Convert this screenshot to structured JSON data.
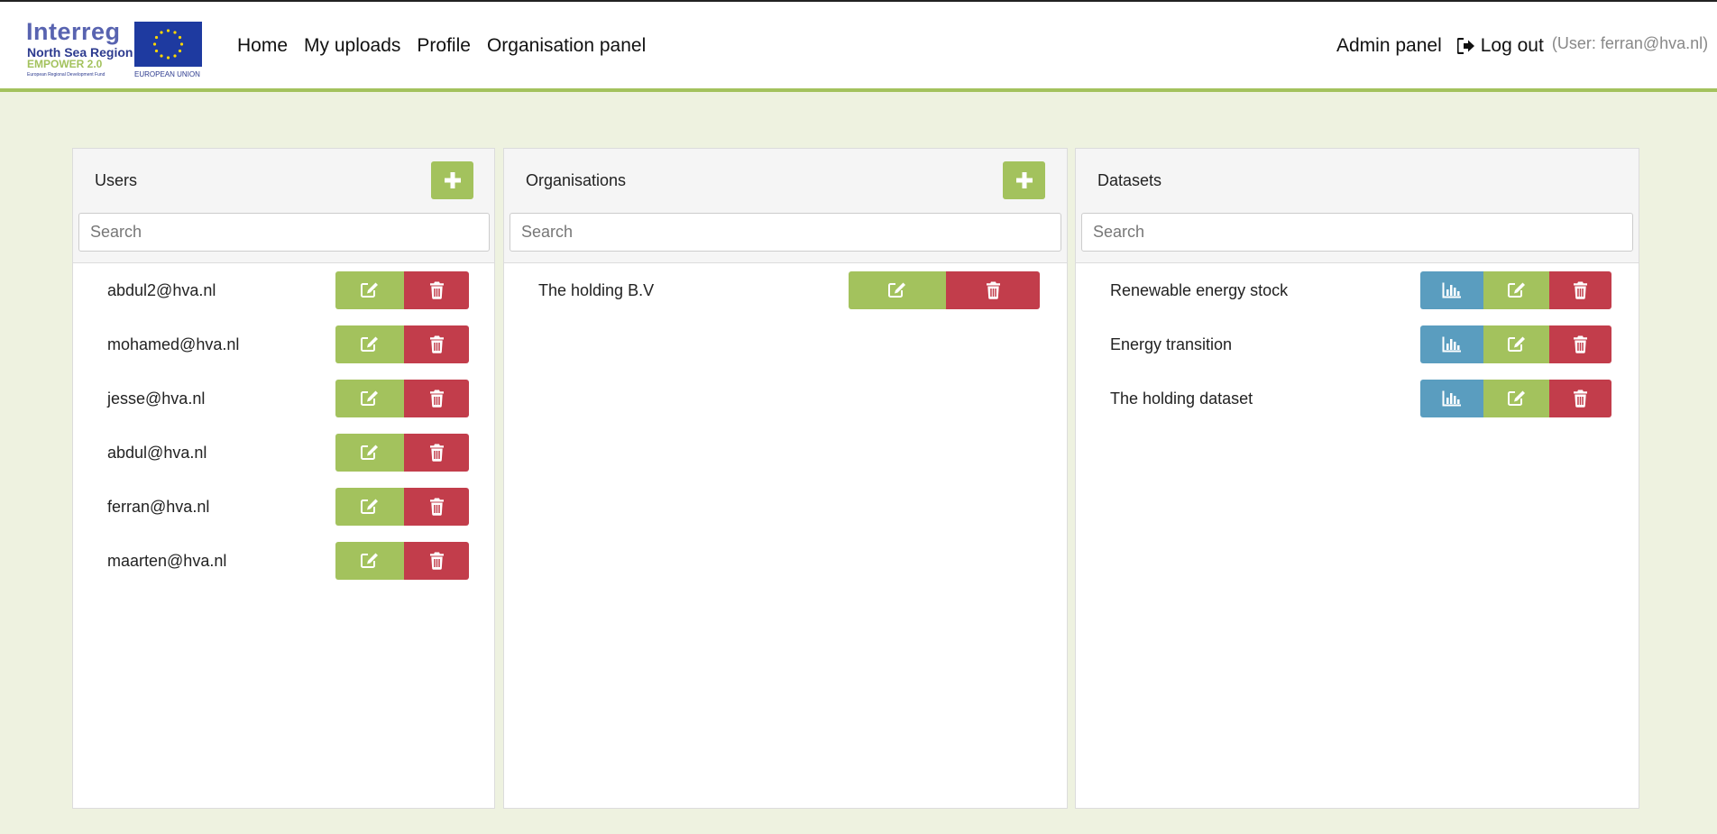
{
  "brand": {
    "title": "Interreg",
    "region": "North Sea Region",
    "project": "EMPOWER 2.0",
    "fund": "European Regional Development Fund",
    "eu_label": "EUROPEAN UNION"
  },
  "nav": {
    "home": "Home",
    "uploads": "My uploads",
    "profile": "Profile",
    "organisation_panel": "Organisation panel",
    "admin_panel": "Admin panel",
    "logout": "Log out",
    "user_info": "(User: ferran@hva.nl)"
  },
  "users": {
    "title": "Users",
    "search_placeholder": "Search",
    "items": [
      "abdul2@hva.nl",
      "mohamed@hva.nl",
      "jesse@hva.nl",
      "abdul@hva.nl",
      "ferran@hva.nl",
      "maarten@hva.nl"
    ]
  },
  "organisations": {
    "title": "Organisations",
    "search_placeholder": "Search",
    "items": [
      "The holding B.V"
    ]
  },
  "datasets": {
    "title": "Datasets",
    "search_placeholder": "Search",
    "items": [
      "Renewable energy stock",
      "Energy transition",
      "The holding dataset"
    ]
  },
  "colors": {
    "accent_green": "#a3c25d",
    "danger_red": "#c23d4b",
    "info_blue": "#5a9dbf",
    "page_bg": "#eef2e0"
  },
  "icons": {
    "add": "plus-icon",
    "edit": "edit-icon",
    "delete": "trash-icon",
    "chart": "bar-chart-icon",
    "logout": "sign-out-icon"
  }
}
